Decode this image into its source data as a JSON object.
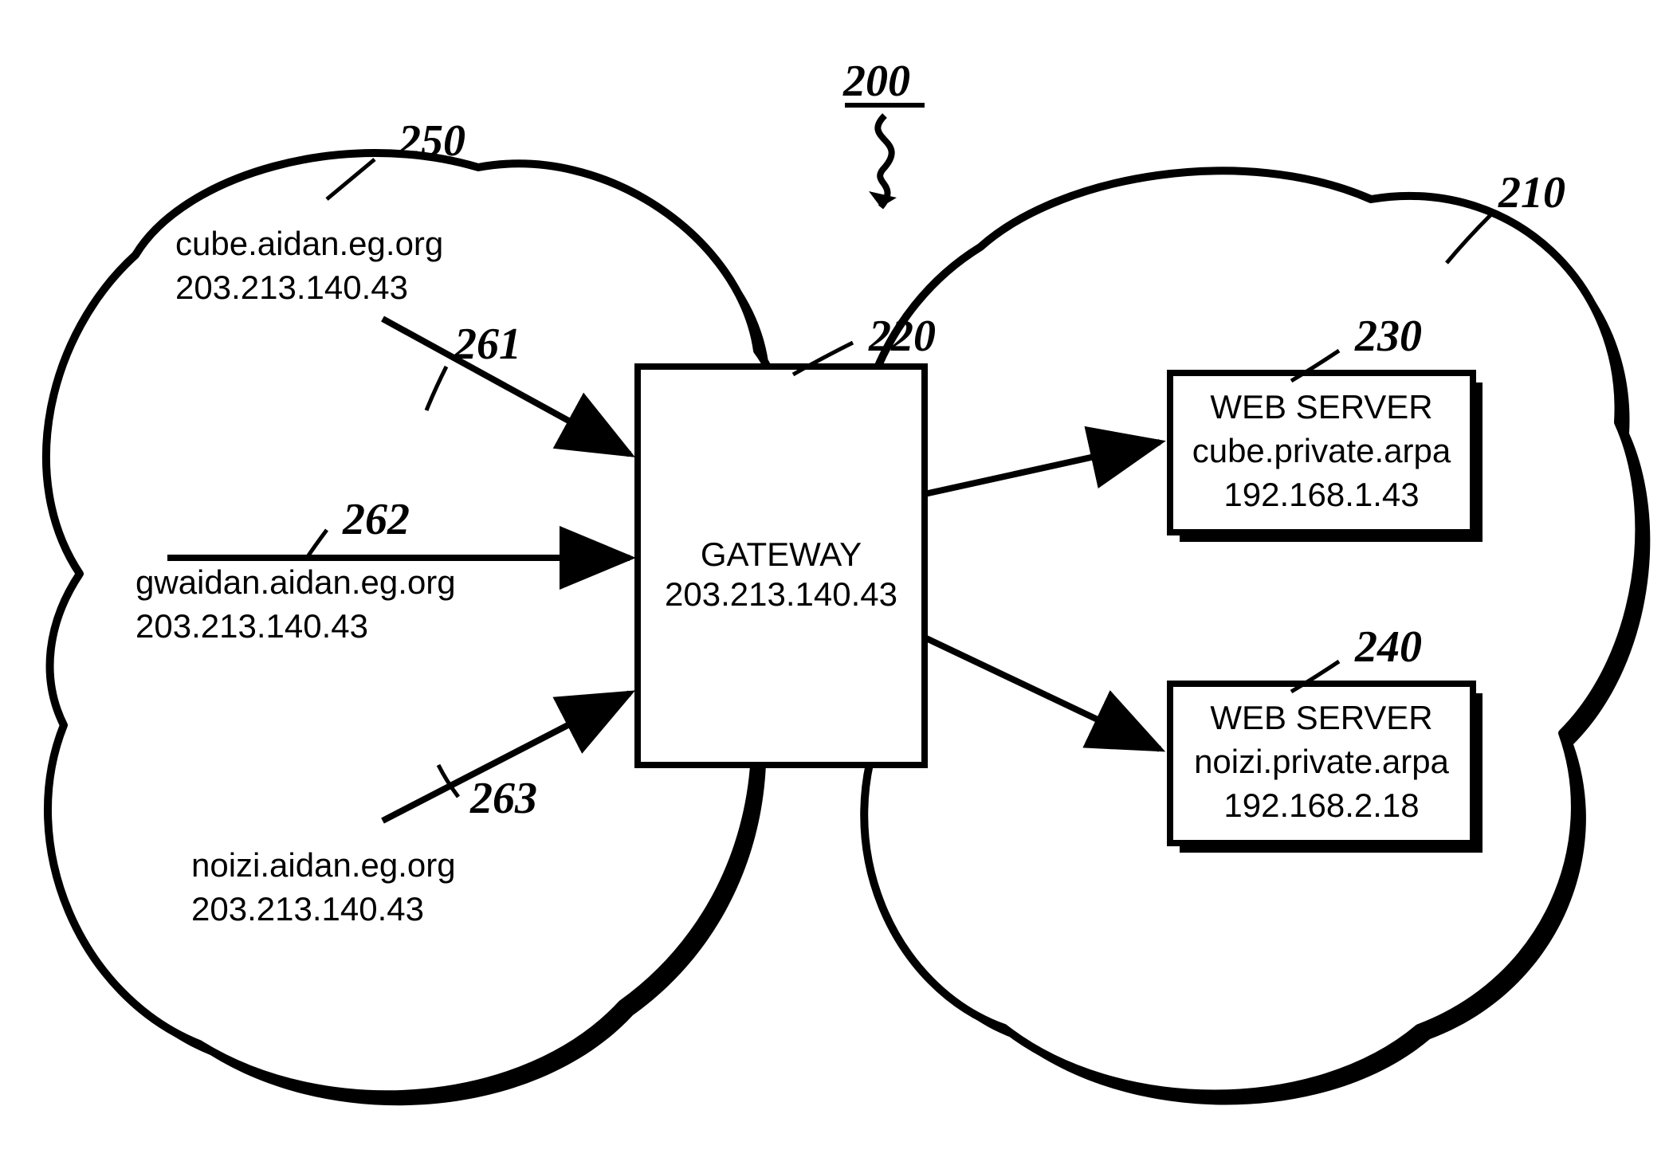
{
  "refs": {
    "figure": "200",
    "left_cloud": "250",
    "right_cloud": "210",
    "gateway": "220",
    "server1": "230",
    "server2": "240",
    "arrow1": "261",
    "arrow2": "262",
    "arrow3": "263"
  },
  "gateway": {
    "title": "GATEWAY",
    "ip": "203.213.140.43"
  },
  "servers": [
    {
      "title": "WEB SERVER",
      "hostname": "cube.private.arpa",
      "ip": "192.168.1.43"
    },
    {
      "title": "WEB SERVER",
      "hostname": "noizi.private.arpa",
      "ip": "192.168.2.18"
    }
  ],
  "hosts": [
    {
      "hostname": "cube.aidan.eg.org",
      "ip": "203.213.140.43"
    },
    {
      "hostname": "gwaidan.aidan.eg.org",
      "ip": "203.213.140.43"
    },
    {
      "hostname": "noizi.aidan.eg.org",
      "ip": "203.213.140.43"
    }
  ]
}
